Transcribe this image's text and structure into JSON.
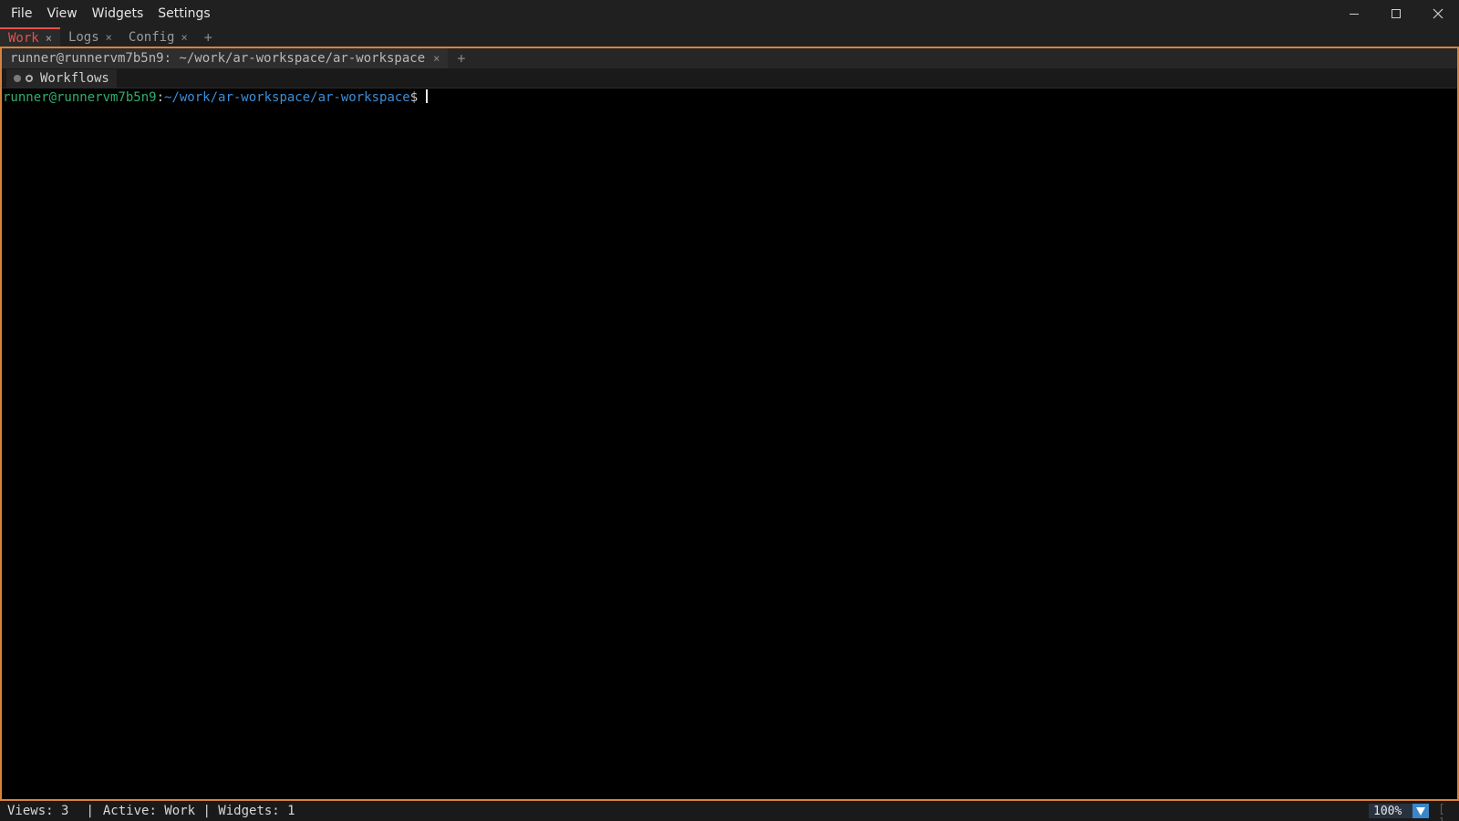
{
  "menu": [
    "File",
    "View",
    "Widgets",
    "Settings"
  ],
  "window_controls": {
    "minimize": "minimize-icon",
    "maximize": "maximize-icon",
    "close": "close-icon"
  },
  "view_tabs": [
    {
      "label": "Work",
      "active": true
    },
    {
      "label": "Logs",
      "active": false
    },
    {
      "label": "Config",
      "active": false
    }
  ],
  "view_tab_close": "×",
  "view_tab_add": "+",
  "terminal_tab": {
    "label": "runner@runnervm7b5n9: ~/work/ar-workspace/ar-workspace",
    "close": "×",
    "add": "+"
  },
  "toolbar": {
    "workflows_label": "Workflows"
  },
  "prompt": {
    "user_host": "runner@runnervm7b5n9",
    "colon": ":",
    "path": "~/work/ar-workspace/ar-workspace",
    "sign": "$"
  },
  "status": {
    "views": "Views: 3",
    "separator": "|",
    "active": "Active: Work | Widgets: 1",
    "zoom": "100%",
    "brackets": "[ ]"
  },
  "colors": {
    "accent": "#e8504a",
    "frame": "#d9823b",
    "prompt_user": "#2fae6e",
    "prompt_path": "#3b8fd9",
    "zoom_button": "#3a86c8"
  }
}
